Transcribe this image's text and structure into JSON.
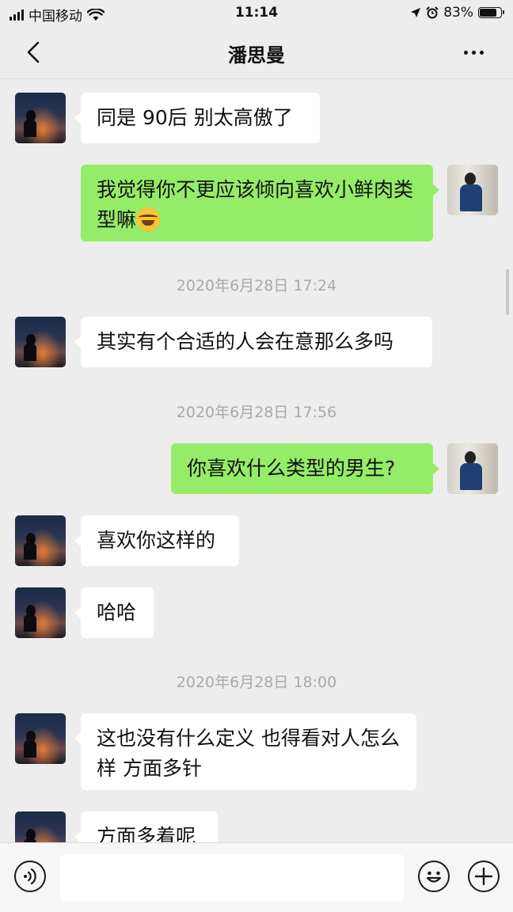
{
  "status_bar": {
    "carrier": "中国移动",
    "time": "11:14",
    "battery_pct": "83%",
    "battery_level": 0.83,
    "icons": [
      "signal-icon",
      "wifi-icon",
      "location-icon",
      "alarm-icon",
      "battery-icon"
    ]
  },
  "nav": {
    "title": "潘思曼",
    "back_icon": "chevron-left-icon",
    "more_icon": "more-dots-icon"
  },
  "messages": [
    {
      "side": "left",
      "text": "同是 90后 别太高傲了"
    },
    {
      "side": "right",
      "text": "我觉得你不更应该倾向喜欢小鲜肉类型嘛",
      "emoji": "laughing-crying-emoji"
    },
    {
      "timestamp": "2020年6月28日 17:24"
    },
    {
      "side": "left",
      "text": "其实有个合适的人会在意那么多吗"
    },
    {
      "timestamp": "2020年6月28日 17:56"
    },
    {
      "side": "right",
      "text": "你喜欢什么类型的男生?"
    },
    {
      "side": "left",
      "text": "喜欢你这样的"
    },
    {
      "side": "left",
      "text": "哈哈"
    },
    {
      "timestamp": "2020年6月28日 18:00"
    },
    {
      "side": "left",
      "text": "这也没有什么定义 也得看对人怎么样 方面多针"
    },
    {
      "side": "left",
      "text": "方面多着呢"
    }
  ],
  "input_bar": {
    "value": "",
    "icons": [
      "voice-icon",
      "emoji-icon",
      "plus-icon"
    ]
  },
  "colors": {
    "background": "#ededed",
    "bubble_sent": "#95ec69",
    "bubble_received": "#ffffff",
    "timestamp": "#a9a9a9"
  }
}
